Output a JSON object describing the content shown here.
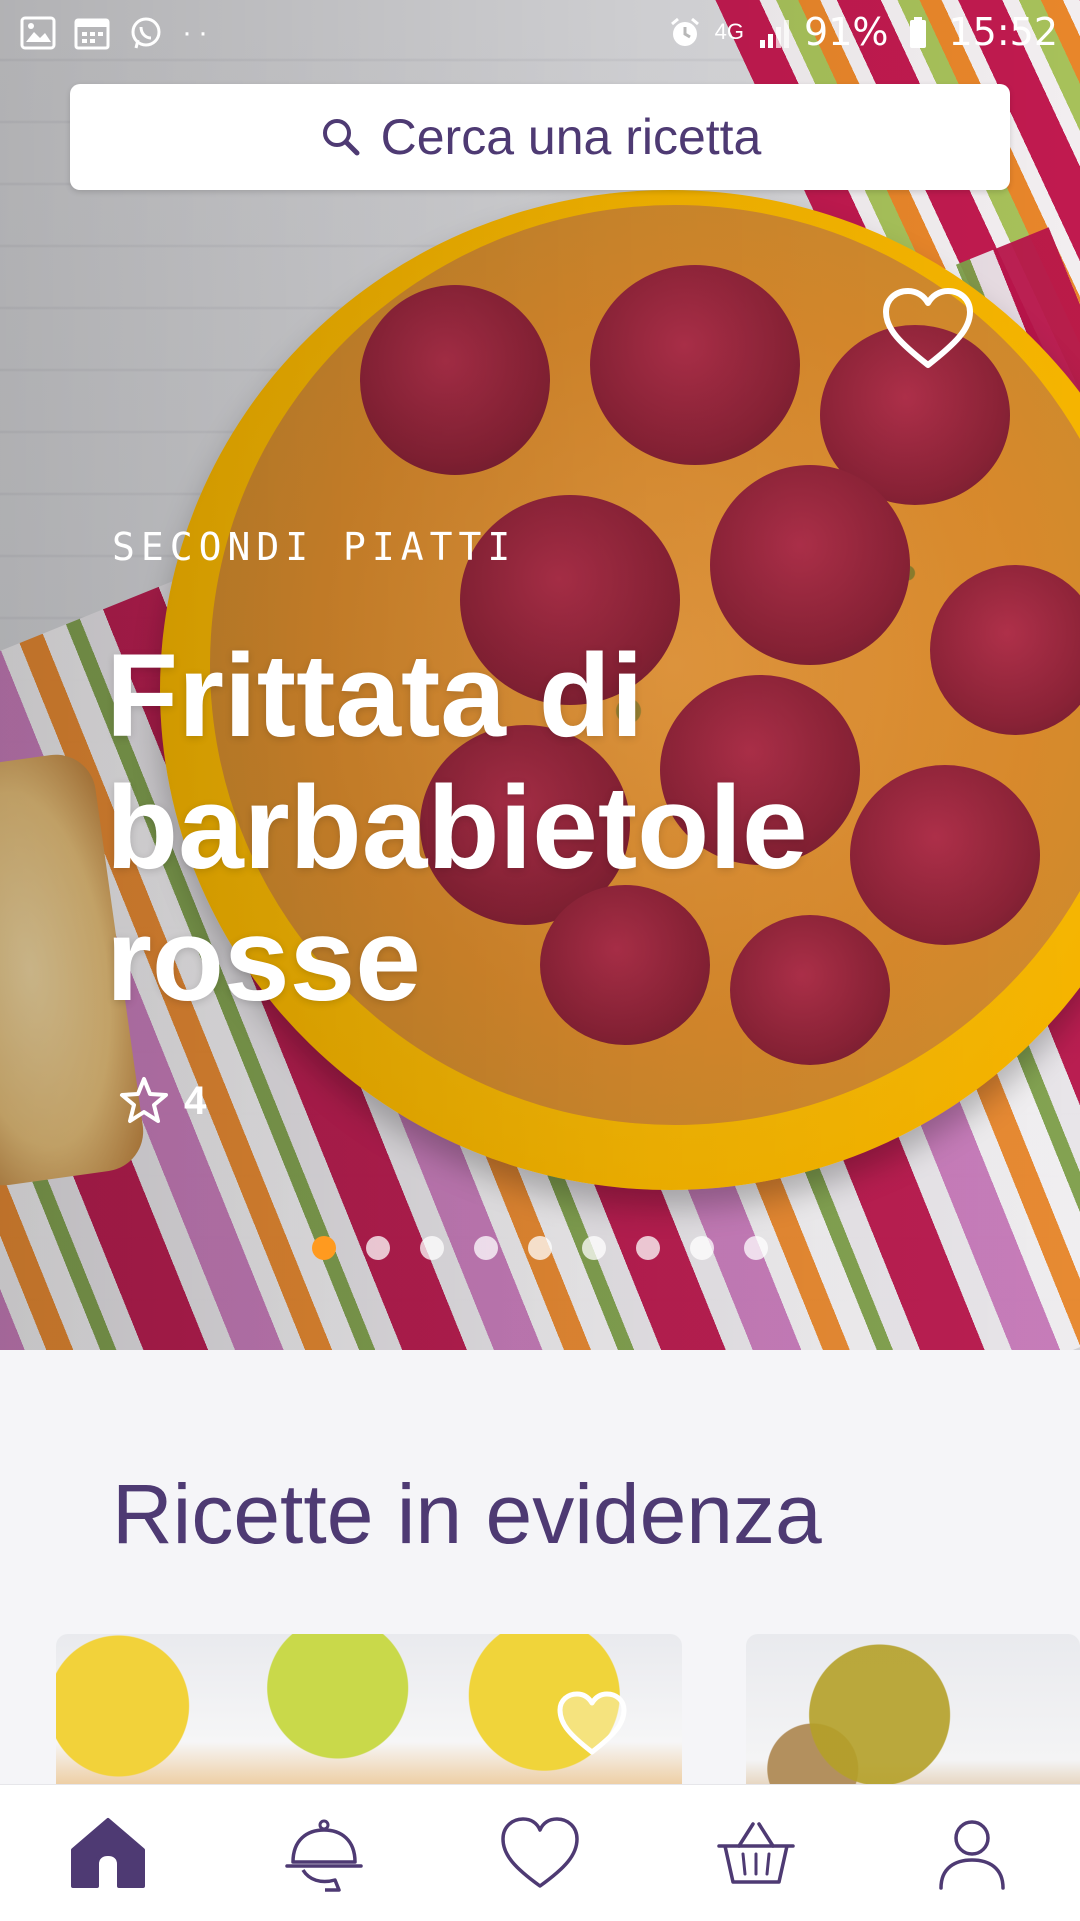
{
  "status_bar": {
    "network": "4G",
    "battery": "91%",
    "time": "15:52"
  },
  "search": {
    "label": "Cerca una ricetta"
  },
  "hero": {
    "category": "SECONDI PIATTI",
    "title": "Frittata di barbabietole rosse",
    "rating": "4",
    "carousel": {
      "active_index": 0,
      "count": 9
    }
  },
  "section": {
    "title": "Ricette in evidenza"
  },
  "colors": {
    "brand_purple": "#4e3a73",
    "accent_orange": "#ff9a1f"
  },
  "bottom_nav": {
    "items": [
      "home-icon",
      "cloche-icon",
      "heart-icon",
      "basket-icon",
      "user-icon"
    ],
    "active": "home-icon"
  }
}
